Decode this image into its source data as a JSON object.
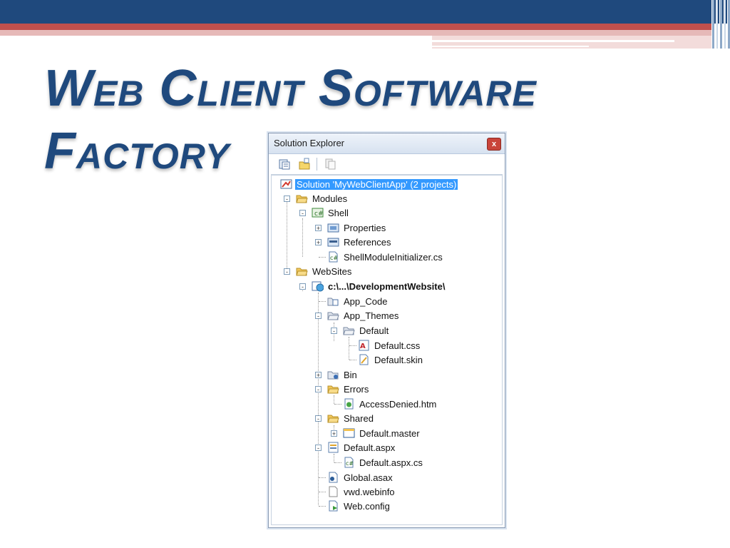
{
  "slide": {
    "title_line1": "Web Client Software",
    "title_line2": "Factory"
  },
  "window": {
    "title": "Solution Explorer",
    "close_label": "x",
    "toolbar": [
      "properties-icon",
      "show-all-files-icon",
      "refresh-icon"
    ]
  },
  "tree": [
    {
      "label": "Solution 'MyWebClientApp' (2 projects)",
      "icon": "solution-icon",
      "selected": true
    },
    {
      "label": "Modules",
      "icon": "folder-open-icon",
      "expander": "-"
    },
    {
      "label": "Shell",
      "icon": "csharp-project-icon",
      "expander": "-"
    },
    {
      "label": "Properties",
      "icon": "properties-folder-icon",
      "expander": "+"
    },
    {
      "label": "References",
      "icon": "references-icon",
      "expander": "+"
    },
    {
      "label": "ShellModuleInitializer.cs",
      "icon": "cs-file-icon"
    },
    {
      "label": "WebSites",
      "icon": "folder-open-icon",
      "expander": "-"
    },
    {
      "label": "c:\\...\\DevelopmentWebsite\\",
      "icon": "website-icon",
      "expander": "-",
      "bold": true
    },
    {
      "label": "App_Code",
      "icon": "app-code-folder-icon"
    },
    {
      "label": "App_Themes",
      "icon": "themes-folder-icon",
      "expander": "-"
    },
    {
      "label": "Default",
      "icon": "folder-icon",
      "expander": "-"
    },
    {
      "label": "Default.css",
      "icon": "css-file-icon"
    },
    {
      "label": "Default.skin",
      "icon": "skin-file-icon"
    },
    {
      "label": "Bin",
      "icon": "bin-folder-icon",
      "expander": "+"
    },
    {
      "label": "Errors",
      "icon": "folder-open-icon",
      "expander": "-"
    },
    {
      "label": "AccessDenied.htm",
      "icon": "htm-file-icon"
    },
    {
      "label": "Shared",
      "icon": "folder-open-icon",
      "expander": "-"
    },
    {
      "label": "Default.master",
      "icon": "master-file-icon",
      "expander": "+"
    },
    {
      "label": "Default.aspx",
      "icon": "aspx-file-icon",
      "expander": "-"
    },
    {
      "label": "Default.aspx.cs",
      "icon": "cs-file-icon"
    },
    {
      "label": "Global.asax",
      "icon": "asax-file-icon"
    },
    {
      "label": "vwd.webinfo",
      "icon": "blank-file-icon"
    },
    {
      "label": "Web.config",
      "icon": "config-file-icon"
    }
  ],
  "colors": {
    "title": "#1f497d",
    "selection": "#3399ff",
    "top_bar": "#1f497d",
    "accent_bar": "#c0504d"
  }
}
